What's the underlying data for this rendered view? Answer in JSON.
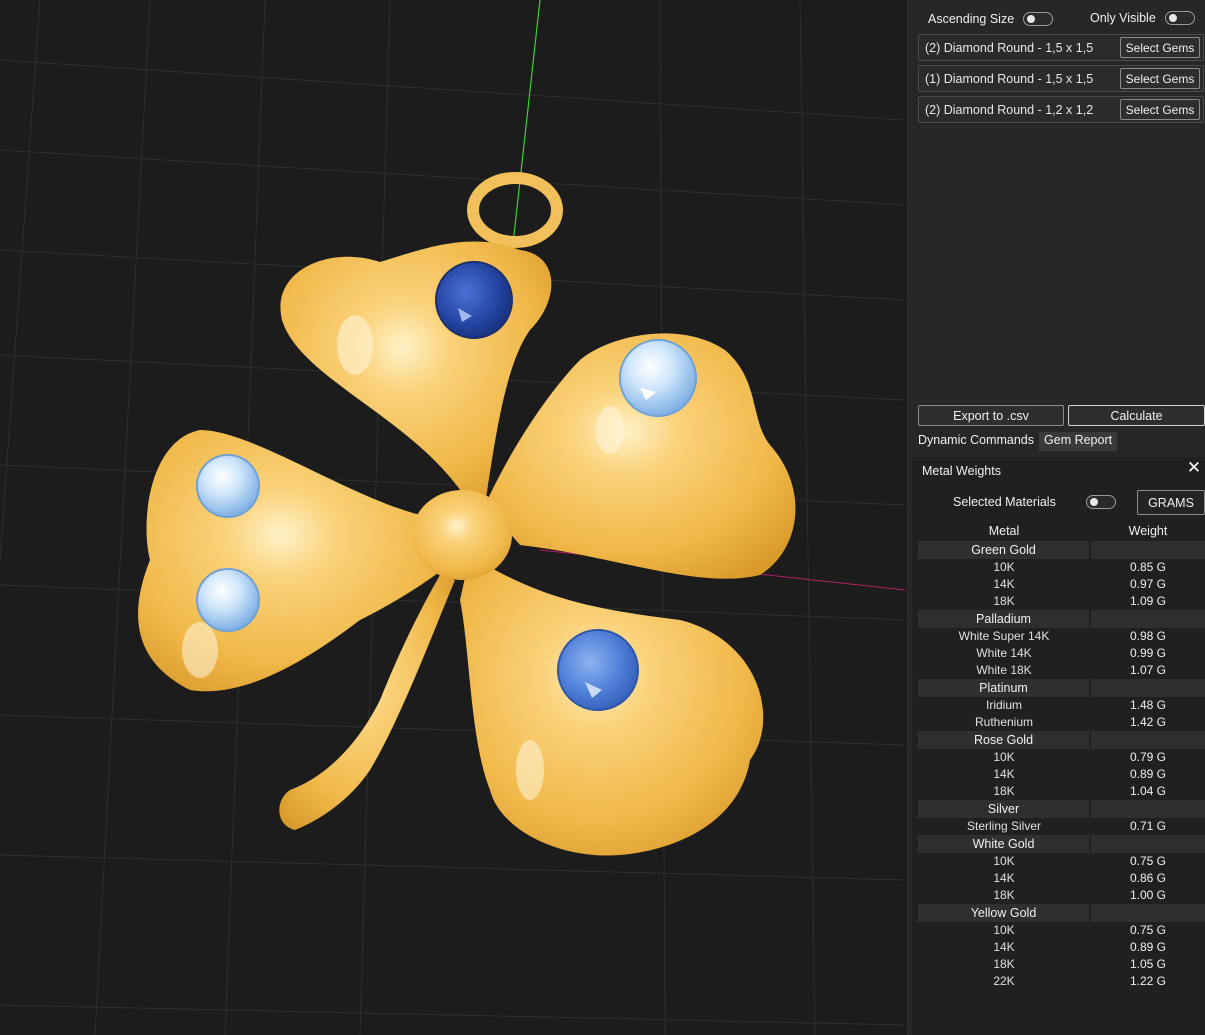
{
  "gem_report": {
    "ascending_size_label": "Ascending Size",
    "ascending_size_on": false,
    "only_visible_label": "Only Visible",
    "only_visible_on": false,
    "gems": [
      {
        "label": "(2) Diamond Round - 1,5 x 1,5",
        "button": "Select Gems"
      },
      {
        "label": "(1) Diamond Round - 1,5 x 1,5",
        "button": "Select Gems"
      },
      {
        "label": "(2) Diamond Round - 1,2 x 1,2",
        "button": "Select Gems"
      }
    ],
    "export_label": "Export to .csv",
    "calculate_label": "Calculate"
  },
  "tabs": [
    {
      "label": "Dynamic Commands",
      "active": false
    },
    {
      "label": "Gem Report",
      "active": true
    }
  ],
  "metal_weights": {
    "title": "Metal Weights",
    "close_icon": "close-icon",
    "selected_materials_label": "Selected Materials",
    "selected_materials_on": false,
    "unit_button": "GRAMS",
    "col_metal": "Metal",
    "col_weight": "Weight",
    "groups": [
      {
        "name": "Green Gold",
        "rows": [
          {
            "metal": "10K",
            "weight": "0.85 G"
          },
          {
            "metal": "14K",
            "weight": "0.97 G"
          },
          {
            "metal": "18K",
            "weight": "1.09 G"
          }
        ]
      },
      {
        "name": "Palladium",
        "rows": [
          {
            "metal": "White Super 14K",
            "weight": "0.98 G"
          },
          {
            "metal": "White 14K",
            "weight": "0.99 G"
          },
          {
            "metal": "White 18K",
            "weight": "1.07 G"
          }
        ]
      },
      {
        "name": "Platinum",
        "rows": [
          {
            "metal": "Iridium",
            "weight": "1.48 G"
          },
          {
            "metal": "Ruthenium",
            "weight": "1.42 G"
          }
        ]
      },
      {
        "name": "Rose Gold",
        "rows": [
          {
            "metal": "10K",
            "weight": "0.79 G"
          },
          {
            "metal": "14K",
            "weight": "0.89 G"
          },
          {
            "metal": "18K",
            "weight": "1.04 G"
          }
        ]
      },
      {
        "name": "Silver",
        "rows": [
          {
            "metal": "Sterling Silver",
            "weight": "0.71 G"
          }
        ]
      },
      {
        "name": "White Gold",
        "rows": [
          {
            "metal": "10K",
            "weight": "0.75 G"
          },
          {
            "metal": "14K",
            "weight": "0.86 G"
          },
          {
            "metal": "18K",
            "weight": "1.00 G"
          }
        ]
      },
      {
        "name": "Yellow Gold",
        "rows": [
          {
            "metal": "10K",
            "weight": "0.75 G"
          },
          {
            "metal": "14K",
            "weight": "0.89 G"
          },
          {
            "metal": "18K",
            "weight": "1.05 G"
          },
          {
            "metal": "22K",
            "weight": "1.22 G"
          }
        ]
      }
    ]
  },
  "colors": {
    "gold": "#f2c05a",
    "sapphire": "#2548a8",
    "light_blue_gem": "#a8d0f2",
    "mid_blue_gem": "#4f7fd8"
  }
}
